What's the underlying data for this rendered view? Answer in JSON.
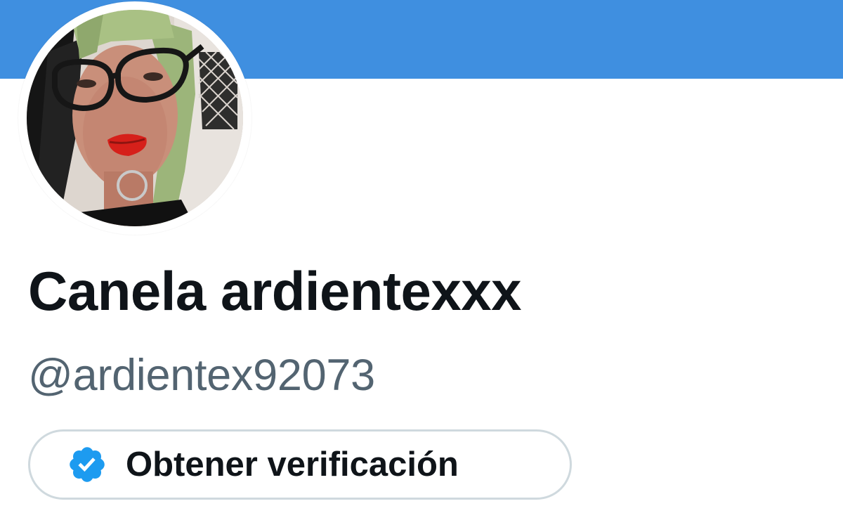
{
  "profile": {
    "display_name": "Canela ardientexxx",
    "handle": "@ardientex92073",
    "avatar_icon": "profile-photo",
    "verify_button": {
      "label": "Obtener verificación",
      "icon": "verified-badge-icon"
    }
  },
  "colors": {
    "banner": "#3f8fe0",
    "badge": "#1d9bf0",
    "name_text": "#0f1419",
    "handle_text": "#536471",
    "button_border": "#cfd9de"
  }
}
